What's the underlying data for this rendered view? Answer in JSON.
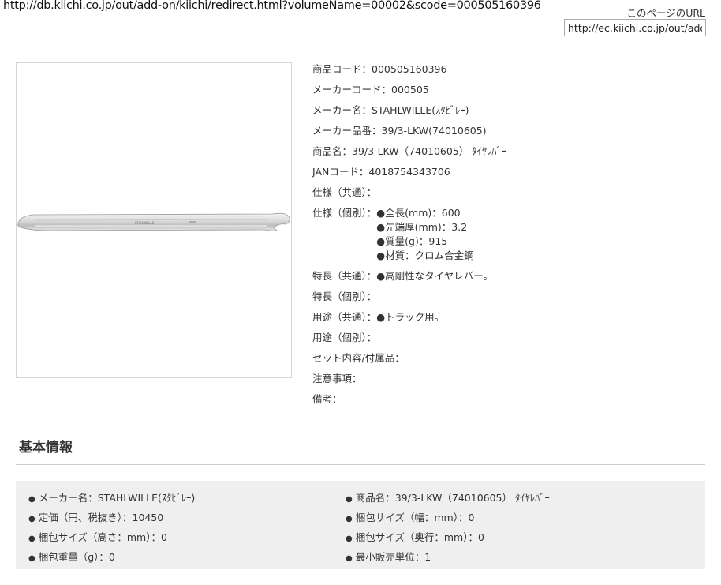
{
  "top": {
    "redirect_url": "http://db.kiichi.co.jp/out/add-on/kiichi/redirect.html?volumeName=00002&scode=000505160396",
    "page_url_label": "このページのURL",
    "page_url_value": "http://ec.kiichi.co.jp/out/add"
  },
  "product_image": {
    "alt": "タイヤレバー",
    "logo_text": "STAHLWILLE"
  },
  "specs": {
    "product_code": {
      "key": "商品コード：",
      "value": "000505160396"
    },
    "maker_code": {
      "key": "メーカーコード：",
      "value": "000505"
    },
    "maker_name": {
      "key": "メーカー名：",
      "value": "STAHLWILLE(ｽﾀﾋﾞﾚｰ)"
    },
    "maker_part_no": {
      "key": "メーカー品番：",
      "value": "39/3-LKW(74010605)"
    },
    "product_name": {
      "key": "商品名：",
      "value": "39/3-LKW（74010605） ﾀｲﾔﾚﾊﾞｰ"
    },
    "jan_code": {
      "key": "JANコード：",
      "value": "4018754343706"
    },
    "spec_common": {
      "key": "仕様（共通）：",
      "value": ""
    },
    "spec_individual": {
      "key": "仕様（個別）：",
      "lines": [
        "●全長(mm)：600",
        "●先端厚(mm)：3.2",
        "●質量(g)：915",
        "●材質：クロム合金鋼"
      ]
    },
    "feature_common": {
      "key": "特長（共通）：",
      "value": "●高剛性なタイヤレバー。"
    },
    "feature_individual": {
      "key": "特長（個別）：",
      "value": ""
    },
    "use_common": {
      "key": "用途（共通）：",
      "value": "●トラック用。"
    },
    "use_individual": {
      "key": "用途（個別）：",
      "value": ""
    },
    "set_contents": {
      "key": "セット内容/付属品：",
      "value": ""
    },
    "notes": {
      "key": "注意事項：",
      "value": ""
    },
    "remarks": {
      "key": "備考：",
      "value": ""
    }
  },
  "basic_info": {
    "title": "基本情報",
    "bullet": "●",
    "left": [
      "メーカー名：STAHLWILLE(ｽﾀﾋﾞﾚｰ)",
      "定価（円、税抜き）：10450",
      "梱包サイズ（高さ：mm）：0",
      "梱包重量（g）：0"
    ],
    "right": [
      "商品名：39/3-LKW（74010605） ﾀｲﾔﾚﾊﾞｰ",
      "梱包サイズ（幅：mm）：0",
      "梱包サイズ（奥行：mm）：0",
      "最小販売単位：1"
    ]
  }
}
